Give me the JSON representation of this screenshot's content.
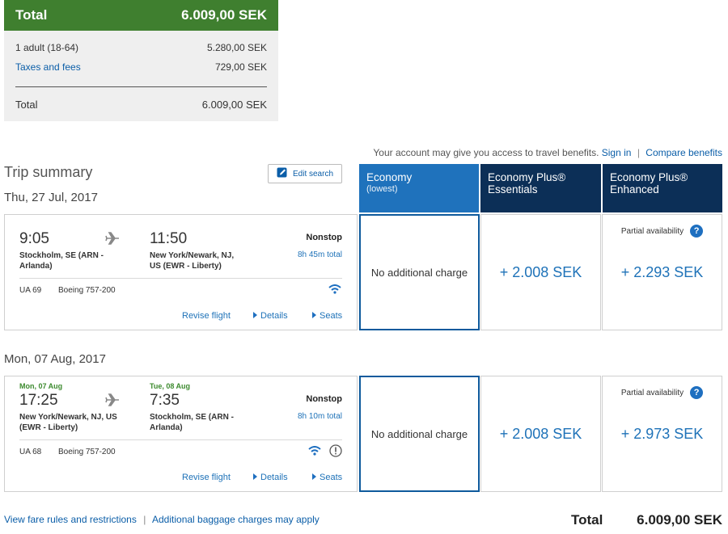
{
  "summary": {
    "total_label": "Total",
    "total_value": "6.009,00 SEK",
    "rows": [
      {
        "label": "1 adult (18-64)",
        "value": "5.280,00 SEK"
      },
      {
        "label": "Taxes and fees",
        "value": "729,00 SEK"
      }
    ],
    "bottom_total_label": "Total",
    "bottom_total_value": "6.009,00 SEK"
  },
  "benefits": {
    "text": "Your account may give you access to travel benefits.",
    "sign_in": "Sign in",
    "compare": "Compare benefits"
  },
  "trip": {
    "title": "Trip summary",
    "edit_search": "Edit search"
  },
  "columns": [
    {
      "title": "Economy",
      "subtitle": "(lowest)",
      "color": "#1f72bc"
    },
    {
      "title": "Economy Plus®",
      "subtitle": "Essentials",
      "color": "#0c2f57"
    },
    {
      "title": "Economy Plus®",
      "subtitle": "Enhanced",
      "color": "#0c2f57"
    }
  ],
  "flights": [
    {
      "date_label": "Thu, 27 Jul, 2017",
      "depart_date": "",
      "arrive_date": "",
      "depart_time": "9:05",
      "arrive_time": "11:50",
      "depart_city": "Stockholm, SE (ARN -",
      "depart_city2": "Arlanda)",
      "arrive_city": "New York/Newark, NJ,",
      "arrive_city2": "US (EWR - Liberty)",
      "stops": "Nonstop",
      "duration": "8h 45m total",
      "flight_no": "UA 69",
      "aircraft": "Boeing 757-200",
      "links": {
        "revise": "Revise flight",
        "details": "Details",
        "seats": "Seats"
      },
      "fares": {
        "economy": "No additional charge",
        "essentials": "+ 2.008 SEK",
        "enhanced": "+ 2.293 SEK",
        "partial": "Partial availability"
      }
    },
    {
      "date_label": "Mon, 07 Aug, 2017",
      "depart_date": "Mon, 07 Aug",
      "arrive_date": "Tue, 08 Aug",
      "depart_time": "17:25",
      "arrive_time": "7:35",
      "depart_city": "New York/Newark, NJ, US",
      "depart_city2": "(EWR - Liberty)",
      "arrive_city": "Stockholm, SE (ARN -",
      "arrive_city2": "Arlanda)",
      "stops": "Nonstop",
      "duration": "8h 10m total",
      "flight_no": "UA 68",
      "aircraft": "Boeing 757-200",
      "links": {
        "revise": "Revise flight",
        "details": "Details",
        "seats": "Seats"
      },
      "fares": {
        "economy": "No additional charge",
        "essentials": "+ 2.008 SEK",
        "enhanced": "+ 2.973 SEK",
        "partial": "Partial availability"
      }
    }
  ],
  "footer": {
    "fare_rules": "View fare rules and restrictions",
    "baggage": "Additional baggage charges may apply",
    "total_label": "Total",
    "total_value": "6.009,00 SEK"
  },
  "icons": {
    "plane": "plane-icon",
    "wifi": "wifi-icon",
    "warning": "alert-icon",
    "help": "help-icon",
    "edit": "pencil-icon"
  }
}
